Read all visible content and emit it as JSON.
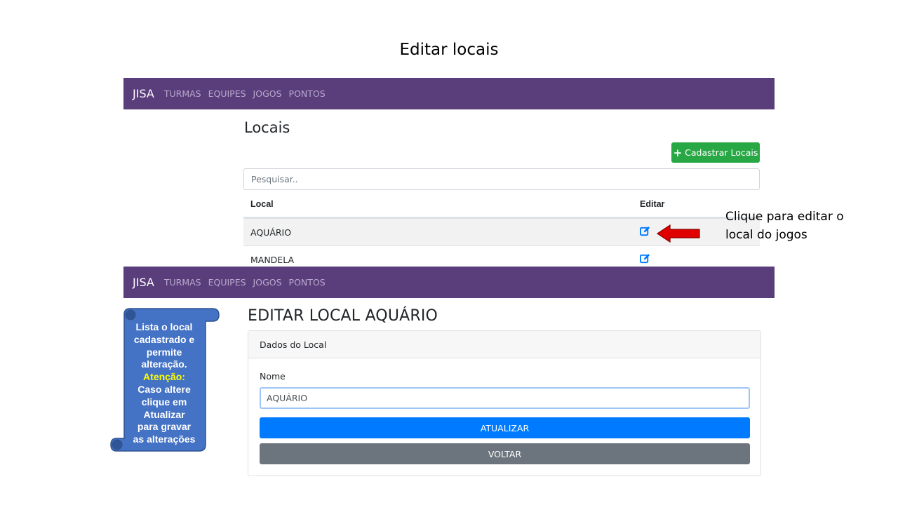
{
  "slide": {
    "title": "Editar locais"
  },
  "nav_top": {
    "brand": "JISA",
    "links": [
      "TURMAS",
      "EQUIPES",
      "JOGOS",
      "PONTOS"
    ]
  },
  "list": {
    "title": "Locais",
    "add_button": "Cadastrar Locais",
    "search_placeholder": "Pesquisar..",
    "headers": {
      "local": "Local",
      "edit": "Editar"
    },
    "rows": [
      {
        "local": "AQUÁRIO"
      },
      {
        "local": "MANDELA"
      }
    ]
  },
  "callout": {
    "line1": "Clique para editar o",
    "line2": "local do jogos"
  },
  "nav_bottom": {
    "brand": "JISA",
    "links": [
      "TURMAS",
      "EQUIPES",
      "JOGOS",
      "PONTOS"
    ]
  },
  "note": {
    "lines": [
      "Lista o local",
      "cadastrado e",
      "permite",
      "alteração."
    ],
    "warning": "Atenção:",
    "lines2": [
      "Caso altere",
      "clique em",
      "Atualizar",
      "para gravar",
      "as alterações"
    ]
  },
  "edit": {
    "title": "EDITAR LOCAL AQUÁRIO",
    "card_header": "Dados do Local",
    "name_label": "Nome",
    "name_value": "AQUÁRIO",
    "update_button": "ATUALIZAR",
    "back_button": "VOLTAR"
  },
  "colors": {
    "navbar": "#5a3e7c",
    "success": "#28a745",
    "primary": "#007bff",
    "secondary": "#6c757d",
    "note_fill": "#4472c4",
    "arrow": "#e00000"
  },
  "icons": {
    "edit": "edit-icon",
    "plus": "plus-icon",
    "arrow": "arrow-left-icon"
  }
}
